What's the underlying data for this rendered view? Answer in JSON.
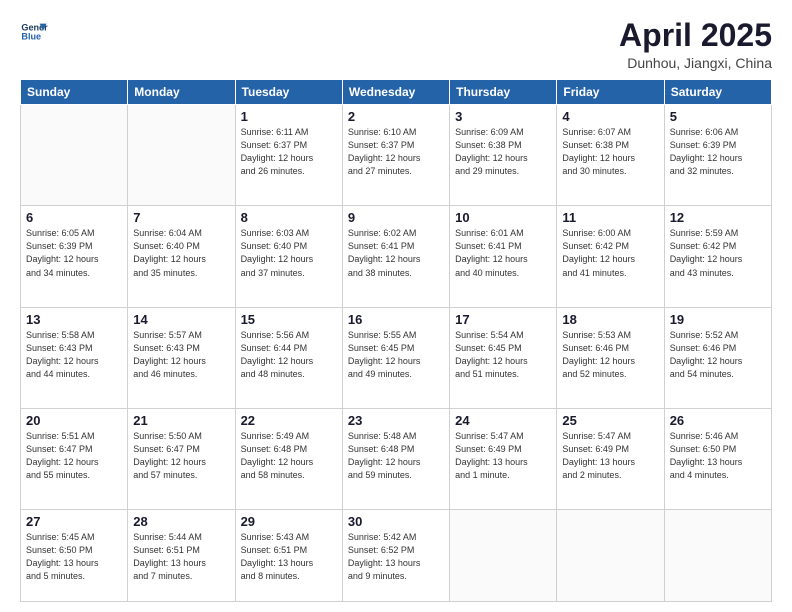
{
  "header": {
    "logo_line1": "General",
    "logo_line2": "Blue",
    "month": "April 2025",
    "location": "Dunhou, Jiangxi, China"
  },
  "weekdays": [
    "Sunday",
    "Monday",
    "Tuesday",
    "Wednesday",
    "Thursday",
    "Friday",
    "Saturday"
  ],
  "weeks": [
    [
      {
        "num": "",
        "info": ""
      },
      {
        "num": "",
        "info": ""
      },
      {
        "num": "1",
        "info": "Sunrise: 6:11 AM\nSunset: 6:37 PM\nDaylight: 12 hours\nand 26 minutes."
      },
      {
        "num": "2",
        "info": "Sunrise: 6:10 AM\nSunset: 6:37 PM\nDaylight: 12 hours\nand 27 minutes."
      },
      {
        "num": "3",
        "info": "Sunrise: 6:09 AM\nSunset: 6:38 PM\nDaylight: 12 hours\nand 29 minutes."
      },
      {
        "num": "4",
        "info": "Sunrise: 6:07 AM\nSunset: 6:38 PM\nDaylight: 12 hours\nand 30 minutes."
      },
      {
        "num": "5",
        "info": "Sunrise: 6:06 AM\nSunset: 6:39 PM\nDaylight: 12 hours\nand 32 minutes."
      }
    ],
    [
      {
        "num": "6",
        "info": "Sunrise: 6:05 AM\nSunset: 6:39 PM\nDaylight: 12 hours\nand 34 minutes."
      },
      {
        "num": "7",
        "info": "Sunrise: 6:04 AM\nSunset: 6:40 PM\nDaylight: 12 hours\nand 35 minutes."
      },
      {
        "num": "8",
        "info": "Sunrise: 6:03 AM\nSunset: 6:40 PM\nDaylight: 12 hours\nand 37 minutes."
      },
      {
        "num": "9",
        "info": "Sunrise: 6:02 AM\nSunset: 6:41 PM\nDaylight: 12 hours\nand 38 minutes."
      },
      {
        "num": "10",
        "info": "Sunrise: 6:01 AM\nSunset: 6:41 PM\nDaylight: 12 hours\nand 40 minutes."
      },
      {
        "num": "11",
        "info": "Sunrise: 6:00 AM\nSunset: 6:42 PM\nDaylight: 12 hours\nand 41 minutes."
      },
      {
        "num": "12",
        "info": "Sunrise: 5:59 AM\nSunset: 6:42 PM\nDaylight: 12 hours\nand 43 minutes."
      }
    ],
    [
      {
        "num": "13",
        "info": "Sunrise: 5:58 AM\nSunset: 6:43 PM\nDaylight: 12 hours\nand 44 minutes."
      },
      {
        "num": "14",
        "info": "Sunrise: 5:57 AM\nSunset: 6:43 PM\nDaylight: 12 hours\nand 46 minutes."
      },
      {
        "num": "15",
        "info": "Sunrise: 5:56 AM\nSunset: 6:44 PM\nDaylight: 12 hours\nand 48 minutes."
      },
      {
        "num": "16",
        "info": "Sunrise: 5:55 AM\nSunset: 6:45 PM\nDaylight: 12 hours\nand 49 minutes."
      },
      {
        "num": "17",
        "info": "Sunrise: 5:54 AM\nSunset: 6:45 PM\nDaylight: 12 hours\nand 51 minutes."
      },
      {
        "num": "18",
        "info": "Sunrise: 5:53 AM\nSunset: 6:46 PM\nDaylight: 12 hours\nand 52 minutes."
      },
      {
        "num": "19",
        "info": "Sunrise: 5:52 AM\nSunset: 6:46 PM\nDaylight: 12 hours\nand 54 minutes."
      }
    ],
    [
      {
        "num": "20",
        "info": "Sunrise: 5:51 AM\nSunset: 6:47 PM\nDaylight: 12 hours\nand 55 minutes."
      },
      {
        "num": "21",
        "info": "Sunrise: 5:50 AM\nSunset: 6:47 PM\nDaylight: 12 hours\nand 57 minutes."
      },
      {
        "num": "22",
        "info": "Sunrise: 5:49 AM\nSunset: 6:48 PM\nDaylight: 12 hours\nand 58 minutes."
      },
      {
        "num": "23",
        "info": "Sunrise: 5:48 AM\nSunset: 6:48 PM\nDaylight: 12 hours\nand 59 minutes."
      },
      {
        "num": "24",
        "info": "Sunrise: 5:47 AM\nSunset: 6:49 PM\nDaylight: 13 hours\nand 1 minute."
      },
      {
        "num": "25",
        "info": "Sunrise: 5:47 AM\nSunset: 6:49 PM\nDaylight: 13 hours\nand 2 minutes."
      },
      {
        "num": "26",
        "info": "Sunrise: 5:46 AM\nSunset: 6:50 PM\nDaylight: 13 hours\nand 4 minutes."
      }
    ],
    [
      {
        "num": "27",
        "info": "Sunrise: 5:45 AM\nSunset: 6:50 PM\nDaylight: 13 hours\nand 5 minutes."
      },
      {
        "num": "28",
        "info": "Sunrise: 5:44 AM\nSunset: 6:51 PM\nDaylight: 13 hours\nand 7 minutes."
      },
      {
        "num": "29",
        "info": "Sunrise: 5:43 AM\nSunset: 6:51 PM\nDaylight: 13 hours\nand 8 minutes."
      },
      {
        "num": "30",
        "info": "Sunrise: 5:42 AM\nSunset: 6:52 PM\nDaylight: 13 hours\nand 9 minutes."
      },
      {
        "num": "",
        "info": ""
      },
      {
        "num": "",
        "info": ""
      },
      {
        "num": "",
        "info": ""
      }
    ]
  ]
}
